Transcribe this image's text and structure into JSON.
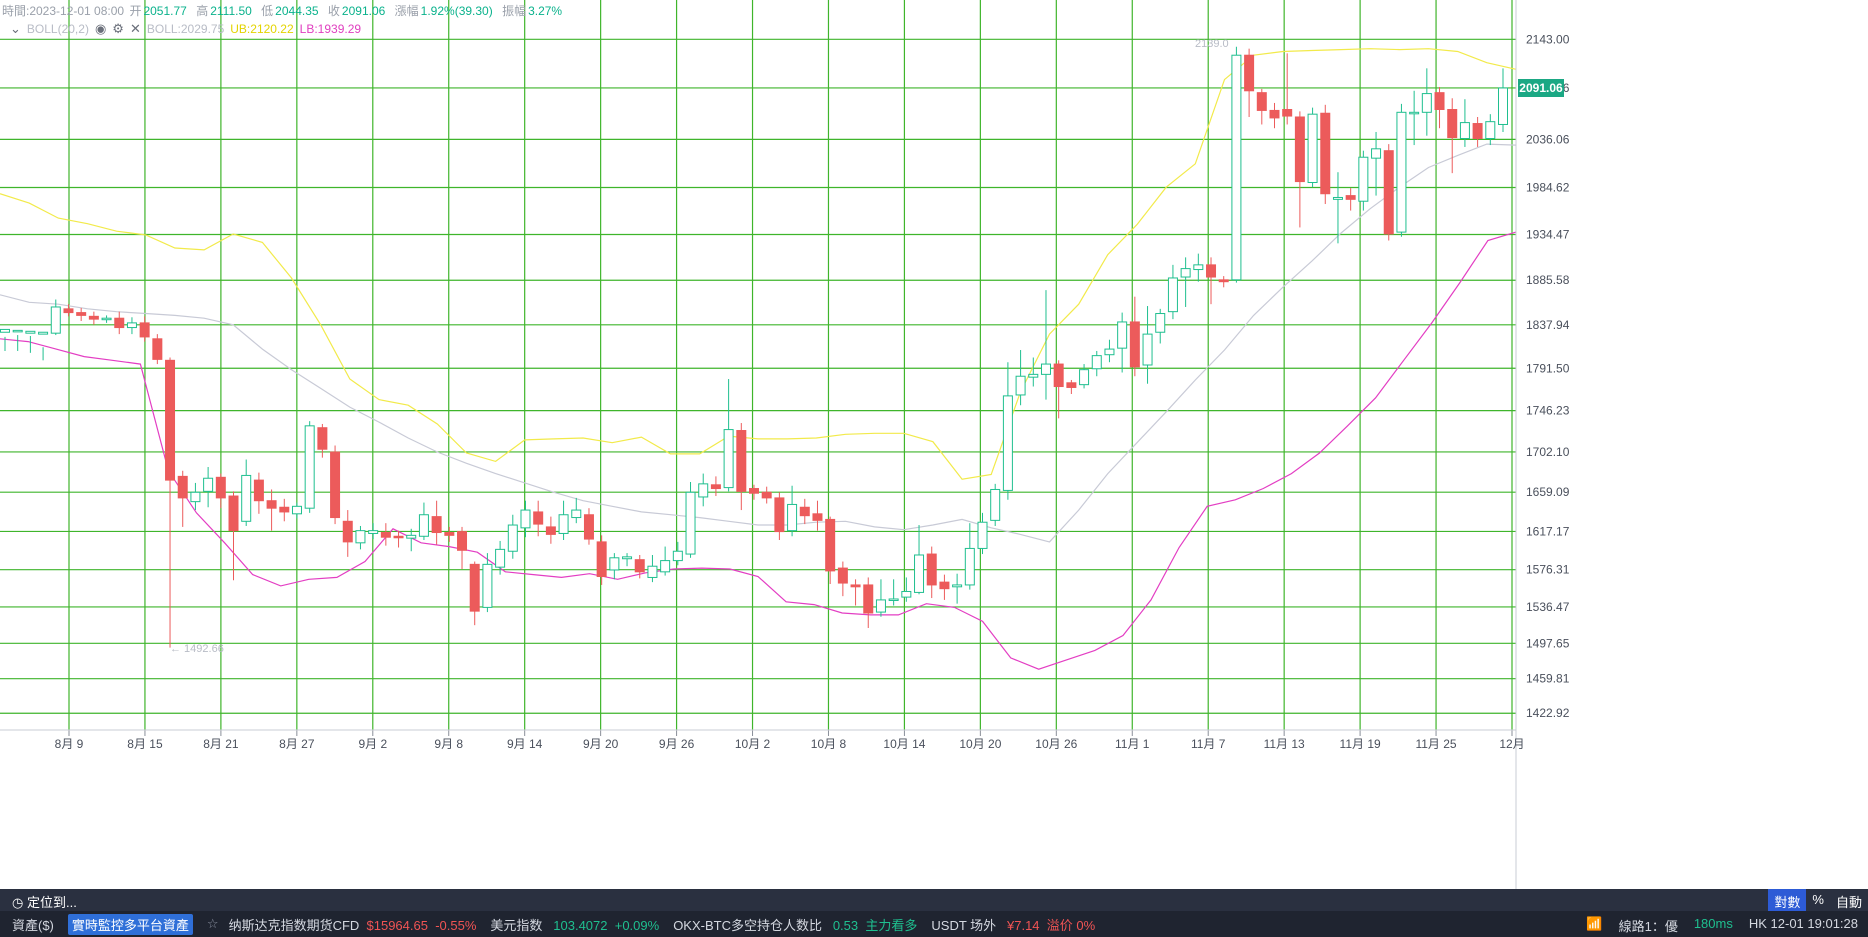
{
  "ohlc": {
    "time_label": "時間:2023-12-01 08:00",
    "open_label": "开",
    "open": "2051.77",
    "high_label": "高",
    "high": "2111.50",
    "low_label": "低",
    "low": "2044.35",
    "close_label": "收",
    "close": "2091.06",
    "change_label": "漲幅",
    "change": "1.92%(39.30)",
    "amp_label": "振幅",
    "amp": "3.27%"
  },
  "indicator": {
    "boll_label": "BOLL(20,2)",
    "mid": "BOLL:2029.75",
    "ub": "UB:2120.22",
    "lb": "LB:1939.29"
  },
  "price_tag": "2091.06",
  "annotations": {
    "high_mark": "2139.0",
    "low_mark": "← 1492.66"
  },
  "colors": {
    "up": "#1fbf8f",
    "down": "#ec5b5b",
    "grid": "#3fb52b",
    "ub": "#f2ea4a",
    "lb": "#e33ec3",
    "mid": "#c8cad6"
  },
  "chart_data": {
    "type": "candlestick",
    "y_ticks": [
      "2143.00",
      "2091.06",
      "2036.06",
      "1984.62",
      "1934.47",
      "1885.58",
      "1837.94",
      "1791.50",
      "1746.23",
      "1702.10",
      "1659.09",
      "1617.17",
      "1576.31",
      "1536.47",
      "1497.65",
      "1459.81",
      "1422.92"
    ],
    "x_ticks": [
      "8月 9",
      "8月 15",
      "8月 21",
      "8月 27",
      "9月 2",
      "9月 8",
      "9月 14",
      "9月 20",
      "9月 26",
      "10月 2",
      "10月 8",
      "10月 14",
      "10月 20",
      "10月 26",
      "11月 1",
      "11月 7",
      "11月 13",
      "11月 19",
      "11月 25",
      "12月"
    ],
    "ylim": [
      1405,
      2185
    ],
    "candles": [
      [
        1830,
        1833,
        1825,
        1810
      ],
      [
        1831,
        1832,
        1827,
        1810
      ],
      [
        1829,
        1831,
        1826,
        1808
      ],
      [
        1828,
        1830,
        1800,
        1814
      ],
      [
        1829,
        1857,
        1865,
        1827
      ],
      [
        1855,
        1851,
        1860,
        1847
      ],
      [
        1851,
        1848,
        1856,
        1842
      ],
      [
        1847,
        1844,
        1852,
        1838
      ],
      [
        1844,
        1845,
        1848,
        1840
      ],
      [
        1845,
        1835,
        1852,
        1828
      ],
      [
        1835,
        1840,
        1846,
        1828
      ],
      [
        1840,
        1825,
        1847,
        1820
      ],
      [
        1823,
        1801,
        1828,
        1796
      ],
      [
        1800,
        1672,
        1803,
        1493
      ],
      [
        1676,
        1653,
        1682,
        1622
      ],
      [
        1649,
        1659,
        1669,
        1640
      ],
      [
        1660,
        1674,
        1686,
        1643
      ],
      [
        1675,
        1653,
        1679,
        1642
      ],
      [
        1655,
        1618,
        1660,
        1565
      ],
      [
        1628,
        1677,
        1694,
        1623
      ],
      [
        1672,
        1650,
        1680,
        1636
      ],
      [
        1650,
        1642,
        1662,
        1618
      ],
      [
        1643,
        1638,
        1652,
        1628
      ],
      [
        1636,
        1644,
        1648,
        1631
      ],
      [
        1642,
        1730,
        1735,
        1637
      ],
      [
        1728,
        1705,
        1732,
        1696
      ],
      [
        1702,
        1632,
        1709,
        1625
      ],
      [
        1628,
        1606,
        1640,
        1590
      ],
      [
        1605,
        1618,
        1623,
        1598
      ],
      [
        1615,
        1618,
        1626,
        1609
      ],
      [
        1616,
        1611,
        1626,
        1602
      ],
      [
        1612,
        1611,
        1618,
        1600
      ],
      [
        1610,
        1613,
        1620,
        1596
      ],
      [
        1612,
        1635,
        1648,
        1608
      ],
      [
        1633,
        1616,
        1650,
        1603
      ],
      [
        1616,
        1613,
        1622,
        1606
      ],
      [
        1617,
        1597,
        1622,
        1577
      ],
      [
        1582,
        1532,
        1585,
        1517
      ],
      [
        1536,
        1582,
        1594,
        1531
      ],
      [
        1579,
        1598,
        1607,
        1571
      ],
      [
        1596,
        1624,
        1635,
        1588
      ],
      [
        1621,
        1640,
        1650,
        1611
      ],
      [
        1638,
        1625,
        1650,
        1612
      ],
      [
        1622,
        1614,
        1633,
        1604
      ],
      [
        1615,
        1635,
        1650,
        1608
      ],
      [
        1632,
        1640,
        1653,
        1626
      ],
      [
        1635,
        1609,
        1642,
        1603
      ],
      [
        1606,
        1569,
        1613,
        1560
      ],
      [
        1576,
        1589,
        1594,
        1566
      ],
      [
        1588,
        1590,
        1594,
        1580
      ],
      [
        1587,
        1574,
        1592,
        1567
      ],
      [
        1568,
        1580,
        1592,
        1563
      ],
      [
        1574,
        1586,
        1601,
        1570
      ],
      [
        1586,
        1596,
        1606,
        1581
      ],
      [
        1593,
        1659,
        1670,
        1589
      ],
      [
        1654,
        1668,
        1679,
        1644
      ],
      [
        1667,
        1663,
        1676,
        1655
      ],
      [
        1664,
        1726,
        1780,
        1660
      ],
      [
        1725,
        1660,
        1733,
        1640
      ],
      [
        1663,
        1658,
        1667,
        1651
      ],
      [
        1659,
        1653,
        1665,
        1647
      ],
      [
        1653,
        1617,
        1659,
        1608
      ],
      [
        1618,
        1646,
        1666,
        1612
      ],
      [
        1643,
        1634,
        1652,
        1625
      ],
      [
        1636,
        1629,
        1650,
        1618
      ],
      [
        1630,
        1575,
        1633,
        1561
      ],
      [
        1578,
        1562,
        1585,
        1548
      ],
      [
        1560,
        1558,
        1566,
        1538
      ],
      [
        1560,
        1530,
        1568,
        1514
      ],
      [
        1531,
        1544,
        1566,
        1526
      ],
      [
        1544,
        1545,
        1566,
        1538
      ],
      [
        1547,
        1553,
        1568,
        1542
      ],
      [
        1552,
        1592,
        1624,
        1550
      ],
      [
        1593,
        1560,
        1601,
        1546
      ],
      [
        1563,
        1556,
        1571,
        1544
      ],
      [
        1558,
        1560,
        1572,
        1540
      ],
      [
        1560,
        1599,
        1626,
        1555
      ],
      [
        1599,
        1627,
        1637,
        1593
      ],
      [
        1629,
        1662,
        1668,
        1623
      ],
      [
        1661,
        1762,
        1798,
        1651
      ],
      [
        1763,
        1783,
        1811,
        1752
      ],
      [
        1782,
        1785,
        1803,
        1772
      ],
      [
        1785,
        1796,
        1875,
        1758
      ],
      [
        1796,
        1772,
        1800,
        1738
      ],
      [
        1776,
        1771,
        1779,
        1764
      ],
      [
        1774,
        1790,
        1796,
        1770
      ],
      [
        1791,
        1805,
        1810,
        1783
      ],
      [
        1806,
        1812,
        1822,
        1798
      ],
      [
        1813,
        1841,
        1851,
        1787
      ],
      [
        1841,
        1793,
        1868,
        1783
      ],
      [
        1795,
        1828,
        1858,
        1775
      ],
      [
        1830,
        1850,
        1855,
        1818
      ],
      [
        1852,
        1888,
        1902,
        1844
      ],
      [
        1889,
        1898,
        1910,
        1857
      ],
      [
        1897,
        1902,
        1914,
        1884
      ],
      [
        1902,
        1889,
        1910,
        1860
      ],
      [
        1886,
        1884,
        1890,
        1878
      ],
      [
        1886,
        2126,
        2135,
        1883
      ],
      [
        2126,
        2088,
        2133,
        2060
      ],
      [
        2086,
        2067,
        2090,
        2052
      ],
      [
        2067,
        2059,
        2075,
        2048
      ],
      [
        2068,
        2061,
        2128,
        2052
      ],
      [
        2060,
        1991,
        2066,
        1942
      ],
      [
        1990,
        2063,
        2070,
        1985
      ],
      [
        2064,
        1978,
        2073,
        1967
      ],
      [
        1972,
        1974,
        2001,
        1925
      ],
      [
        1976,
        1972,
        1984,
        1960
      ],
      [
        1970,
        2017,
        2024,
        1960
      ],
      [
        2016,
        2026,
        2044,
        1976
      ],
      [
        2024,
        1935,
        2031,
        1928
      ],
      [
        1937,
        2065,
        2074,
        1932
      ],
      [
        2064,
        2065,
        2088,
        2030
      ],
      [
        2065,
        2085,
        2112,
        2040
      ],
      [
        2086,
        2068,
        2092,
        2048
      ],
      [
        2068,
        2038,
        2080,
        2000
      ],
      [
        2037,
        2054,
        2079,
        2028
      ],
      [
        2053,
        2037,
        2060,
        2028
      ],
      [
        2037,
        2055,
        2063,
        2030
      ],
      [
        2052,
        2091,
        2112,
        2044
      ]
    ],
    "bollinger": {
      "mid": [
        1870,
        1862,
        1860,
        1855,
        1852,
        1850,
        1848,
        1845,
        1838,
        1812,
        1790,
        1770,
        1750,
        1734,
        1717,
        1702,
        1690,
        1679,
        1669,
        1659,
        1650,
        1644,
        1638,
        1635,
        1632,
        1628,
        1624,
        1624,
        1627,
        1628,
        1622,
        1619,
        1624,
        1630,
        1621,
        1614,
        1606,
        1640,
        1679,
        1712,
        1745,
        1779,
        1811,
        1848,
        1878,
        1906,
        1936,
        1962,
        1985,
        2006,
        2019,
        2031,
        2030
      ],
      "ub": [
        1978,
        1968,
        1952,
        1946,
        1938,
        1934,
        1920,
        1918,
        1935,
        1926,
        1888,
        1838,
        1780,
        1758,
        1752,
        1732,
        1701,
        1692,
        1715,
        1716,
        1717,
        1712,
        1718,
        1700,
        1700,
        1719,
        1716,
        1716,
        1717,
        1721,
        1722,
        1722,
        1713,
        1673,
        1678,
        1766,
        1828,
        1860,
        1913,
        1945,
        1985,
        2010,
        2100,
        2126,
        2130,
        2131,
        2132,
        2133,
        2132,
        2133,
        2130,
        2118,
        2111
      ],
      "lb": [
        1823,
        1820,
        1812,
        1804,
        1800,
        1796,
        1682,
        1637,
        1605,
        1571,
        1559,
        1566,
        1568,
        1585,
        1620,
        1605,
        1601,
        1595,
        1574,
        1571,
        1568,
        1572,
        1566,
        1573,
        1577,
        1578,
        1577,
        1569,
        1542,
        1539,
        1530,
        1528,
        1528,
        1540,
        1536,
        1521,
        1482,
        1470,
        1480,
        1490,
        1506,
        1544,
        1600,
        1644,
        1651,
        1663,
        1679,
        1701,
        1730,
        1760,
        1800,
        1840,
        1883,
        1928,
        1937
      ]
    }
  },
  "bottom": {
    "locate": "定位到...",
    "tr_tabs": [
      "對數",
      "%",
      "自動"
    ],
    "assets_label": "資產($)",
    "assets_chip": "實時監控多平台資產",
    "t1_name": "纳斯达克指数期货CFD",
    "t1_val": "$15964.65",
    "t1_chg": "-0.55%",
    "t2_name": "美元指数",
    "t2_val": "103.4072",
    "t2_chg": "+0.09%",
    "t3_name": "OKX-BTC多空持仓人数比",
    "t3_val": "0.53",
    "t3_note": "主力看多",
    "t4_name": "USDT 场外",
    "t4_val": "¥7.14",
    "t4_note": "溢价 0%",
    "line": "線路1：優",
    "latency": "180ms",
    "clock": "HK 12-01 19:01:28"
  }
}
